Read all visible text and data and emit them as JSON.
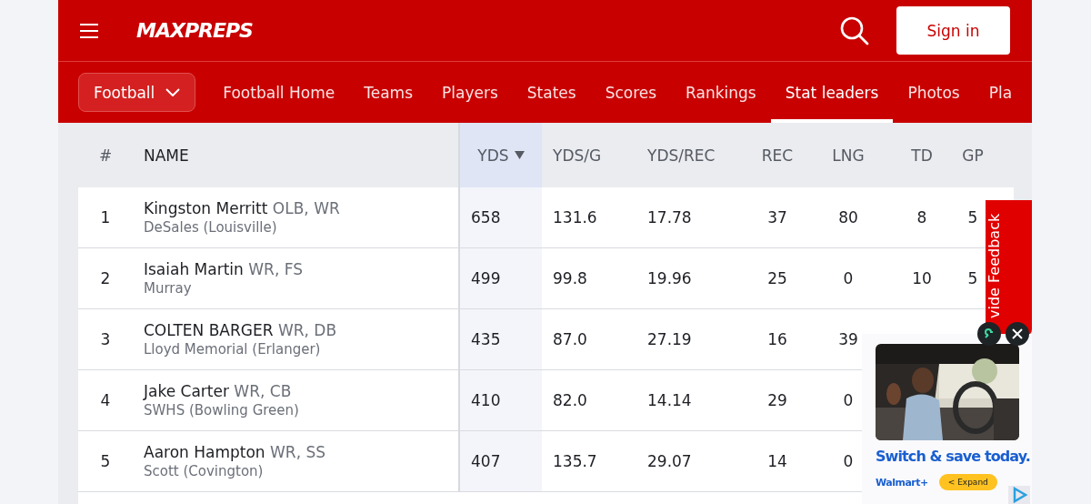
{
  "header": {
    "logo": "MAXPREPS",
    "sign_in": "Sign in"
  },
  "nav": {
    "sport": "Football",
    "items": [
      {
        "label": "Football Home",
        "selected": false
      },
      {
        "label": "Teams",
        "selected": false
      },
      {
        "label": "Players",
        "selected": false
      },
      {
        "label": "States",
        "selected": false
      },
      {
        "label": "Scores",
        "selected": false
      },
      {
        "label": "Rankings",
        "selected": false
      },
      {
        "label": "Stat leaders",
        "selected": true
      },
      {
        "label": "Photos",
        "selected": false
      },
      {
        "label": "Pla",
        "selected": false
      }
    ]
  },
  "table": {
    "columns": [
      {
        "label": "#",
        "sorted": false
      },
      {
        "label": "NAME",
        "sorted": false
      },
      {
        "label": "YDS",
        "sorted": true
      },
      {
        "label": "YDS/G",
        "sorted": false
      },
      {
        "label": "YDS/REC",
        "sorted": false
      },
      {
        "label": "REC",
        "sorted": false
      },
      {
        "label": "LNG",
        "sorted": false
      },
      {
        "label": "TD",
        "sorted": false
      },
      {
        "label": "GP",
        "sorted": false
      }
    ],
    "rows": [
      {
        "rank": "1",
        "name": "Kingston Merritt",
        "positions": "OLB, WR",
        "school": "DeSales (Louisville)",
        "stats": [
          "658",
          "131.6",
          "17.78",
          "37",
          "80",
          "8",
          "5"
        ]
      },
      {
        "rank": "2",
        "name": "Isaiah Martin",
        "positions": "WR, FS",
        "school": "Murray",
        "stats": [
          "499",
          "99.8",
          "19.96",
          "25",
          "0",
          "10",
          "5"
        ]
      },
      {
        "rank": "3",
        "name": "COLTEN BARGER",
        "positions": "WR, DB",
        "school": "Lloyd Memorial (Erlanger)",
        "stats": [
          "435",
          "87.0",
          "27.19",
          "16",
          "39"
        ]
      },
      {
        "rank": "4",
        "name": "Jake Carter",
        "positions": "WR, CB",
        "school": "SWHS (Bowling Green)",
        "stats": [
          "410",
          "82.0",
          "14.14",
          "29",
          "0"
        ]
      },
      {
        "rank": "5",
        "name": "Aaron Hampton",
        "positions": "WR, SS",
        "school": "Scott (Covington)",
        "stats": [
          "407",
          "135.7",
          "29.07",
          "14",
          "0"
        ]
      }
    ]
  },
  "feedback_tab": {
    "label": "vide Feedback"
  },
  "ad": {
    "kind": "picture",
    "headline": "Switch & save today.",
    "brand": "Walmart+",
    "expand": "< Expand"
  }
}
